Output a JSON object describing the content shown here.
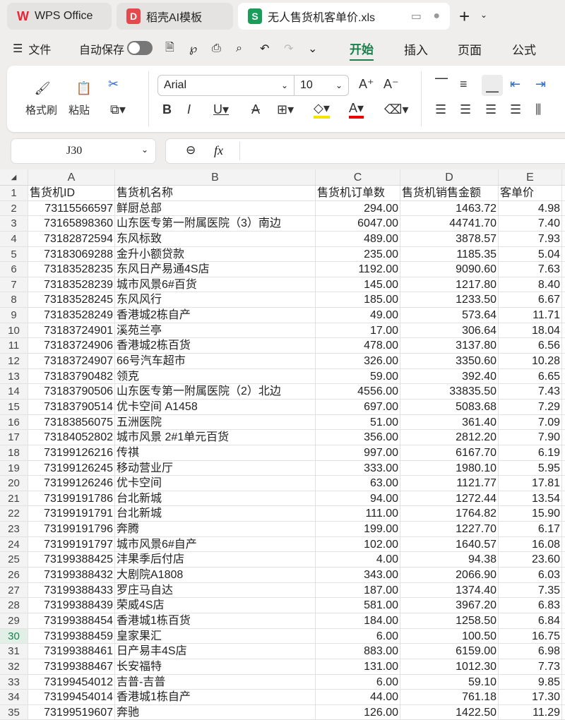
{
  "tabs": [
    {
      "label": "WPS Office"
    },
    {
      "label": "稻壳AI模板"
    },
    {
      "label": "无人售货机客单价.xls"
    }
  ],
  "menu": {
    "file": "文件",
    "autosave": "自动保存",
    "tabs": [
      "开始",
      "插入",
      "页面",
      "公式"
    ]
  },
  "ribbon": {
    "format_painter": "格式刷",
    "paste": "粘贴",
    "font": "Arial",
    "size": "10"
  },
  "formula_bar": {
    "cell_ref": "J30",
    "fx": "fx",
    "value": ""
  },
  "accent": "#1a7f4b",
  "columns": [
    "A",
    "B",
    "C",
    "D",
    "E"
  ],
  "header": [
    "售货机ID",
    "售货机名称",
    "售货机订单数",
    "售货机销售金额",
    "客单价"
  ],
  "rows": [
    [
      "73115566597",
      "鲜厨总部",
      "294.00",
      "1463.72",
      "4.98"
    ],
    [
      "73165898360",
      "山东医专第一附属医院（3）南边",
      "6047.00",
      "44741.70",
      "7.40"
    ],
    [
      "73182872594",
      "东风标致",
      "489.00",
      "3878.57",
      "7.93"
    ],
    [
      "73183069288",
      "金升小额贷款",
      "235.00",
      "1185.35",
      "5.04"
    ],
    [
      "73183528235",
      "东风日产易通4S店",
      "1192.00",
      "9090.60",
      "7.63"
    ],
    [
      "73183528239",
      "城市风景6#百货",
      "145.00",
      "1217.80",
      "8.40"
    ],
    [
      "73183528245",
      "东风风行",
      "185.00",
      "1233.50",
      "6.67"
    ],
    [
      "73183528249",
      "香港城2栋自产",
      "49.00",
      "573.64",
      "11.71"
    ],
    [
      "73183724901",
      "溪苑兰亭",
      "17.00",
      "306.64",
      "18.04"
    ],
    [
      "73183724906",
      "香港城2栋百货",
      "478.00",
      "3137.80",
      "6.56"
    ],
    [
      "73183724907",
      "66号汽车超市",
      "326.00",
      "3350.60",
      "10.28"
    ],
    [
      "73183790482",
      "领克",
      "59.00",
      "392.40",
      "6.65"
    ],
    [
      "73183790506",
      "山东医专第一附属医院（2）北边",
      "4556.00",
      "33835.50",
      "7.43"
    ],
    [
      "73183790514",
      "优卡空间 A1458",
      "697.00",
      "5083.68",
      "7.29"
    ],
    [
      "73183856075",
      "五洲医院",
      "51.00",
      "361.40",
      "7.09"
    ],
    [
      "73184052802",
      "城市风景 2#1单元百货",
      "356.00",
      "2812.20",
      "7.90"
    ],
    [
      "73199126216",
      "传祺",
      "997.00",
      "6167.70",
      "6.19"
    ],
    [
      "73199126245",
      "移动营业厅",
      "333.00",
      "1980.10",
      "5.95"
    ],
    [
      "73199126246",
      "优卡空间",
      "63.00",
      "1121.77",
      "17.81"
    ],
    [
      "73199191786",
      "台北新城",
      "94.00",
      "1272.44",
      "13.54"
    ],
    [
      "73199191791",
      "台北新城",
      "111.00",
      "1764.82",
      "15.90"
    ],
    [
      "73199191796",
      "奔腾",
      "199.00",
      "1227.70",
      "6.17"
    ],
    [
      "73199191797",
      "城市风景6#自产",
      "102.00",
      "1640.57",
      "16.08"
    ],
    [
      "73199388425",
      "沣果季后付店",
      "4.00",
      "94.38",
      "23.60"
    ],
    [
      "73199388432",
      "大剧院A1808",
      "343.00",
      "2066.90",
      "6.03"
    ],
    [
      "73199388433",
      "罗庄马自达",
      "187.00",
      "1374.40",
      "7.35"
    ],
    [
      "73199388439",
      "荣威4S店",
      "581.00",
      "3967.20",
      "6.83"
    ],
    [
      "73199388454",
      "香港城1栋百货",
      "184.00",
      "1258.50",
      "6.84"
    ],
    [
      "73199388459",
      "皇家果汇",
      "6.00",
      "100.50",
      "16.75"
    ],
    [
      "73199388461",
      "日产易丰4S店",
      "883.00",
      "6159.00",
      "6.98"
    ],
    [
      "73199388467",
      "长安福特",
      "131.00",
      "1012.30",
      "7.73"
    ],
    [
      "73199454012",
      "吉普-吉普",
      "6.00",
      "59.10",
      "9.85"
    ],
    [
      "73199454014",
      "香港城1栋自产",
      "44.00",
      "761.18",
      "17.30"
    ],
    [
      "73199519607",
      "奔驰",
      "126.00",
      "1422.50",
      "11.29"
    ]
  ]
}
